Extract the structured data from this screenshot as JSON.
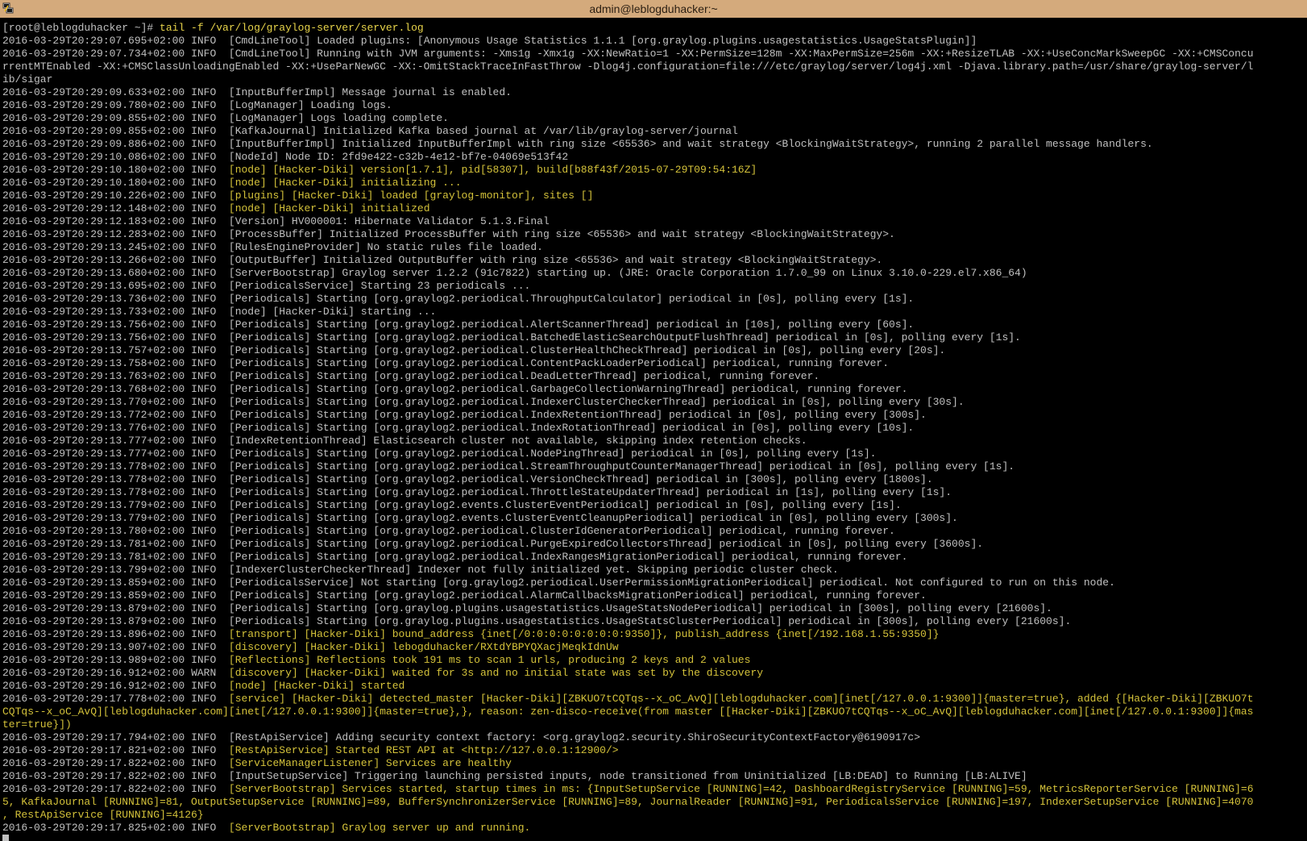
{
  "window": {
    "title": "admin@leblogduhacker:~",
    "icon": "putty-icon"
  },
  "terminal": {
    "prompt": "[root@leblogduhacker ~]# ",
    "command": "tail -f /var/log/graylog-server/server.log",
    "colors": {
      "background": "#000000",
      "foreground": "#c0c0c0",
      "highlight": "#d4c23a",
      "titlebar": "#d4aa7c"
    },
    "lines": [
      {
        "ts": "2016-03-29T20:29:07.695+02:00",
        "lvl": "INFO ",
        "msg": "[CmdLineTool] Loaded plugins: [Anonymous Usage Statistics 1.1.1 [org.graylog.plugins.usagestatistics.UsageStatsPlugin]]",
        "hl": false
      },
      {
        "ts": "2016-03-29T20:29:07.734+02:00",
        "lvl": "INFO ",
        "msg": "[CmdLineTool] Running with JVM arguments: -Xms1g -Xmx1g -XX:NewRatio=1 -XX:PermSize=128m -XX:MaxPermSize=256m -XX:+ResizeTLAB -XX:+UseConcMarkSweepGC -XX:+CMSConcu",
        "hl": false
      },
      {
        "raw": "rrentMTEnabled -XX:+CMSClassUnloadingEnabled -XX:+UseParNewGC -XX:-OmitStackTraceInFastThrow -Dlog4j.configuration=file:///etc/graylog/server/log4j.xml -Djava.library.path=/usr/share/graylog-server/l",
        "hl": false
      },
      {
        "raw": "ib/sigar",
        "hl": false
      },
      {
        "ts": "2016-03-29T20:29:09.633+02:00",
        "lvl": "INFO ",
        "msg": "[InputBufferImpl] Message journal is enabled.",
        "hl": false
      },
      {
        "ts": "2016-03-29T20:29:09.780+02:00",
        "lvl": "INFO ",
        "msg": "[LogManager] Loading logs.",
        "hl": false
      },
      {
        "ts": "2016-03-29T20:29:09.855+02:00",
        "lvl": "INFO ",
        "msg": "[LogManager] Logs loading complete.",
        "hl": false
      },
      {
        "ts": "2016-03-29T20:29:09.855+02:00",
        "lvl": "INFO ",
        "msg": "[KafkaJournal] Initialized Kafka based journal at /var/lib/graylog-server/journal",
        "hl": false
      },
      {
        "ts": "2016-03-29T20:29:09.886+02:00",
        "lvl": "INFO ",
        "msg": "[InputBufferImpl] Initialized InputBufferImpl with ring size <65536> and wait strategy <BlockingWaitStrategy>, running 2 parallel message handlers.",
        "hl": false
      },
      {
        "ts": "2016-03-29T20:29:10.086+02:00",
        "lvl": "INFO ",
        "msg": "[NodeId] Node ID: 2fd9e422-c32b-4e12-bf7e-04069e513f42",
        "hl": false
      },
      {
        "ts": "2016-03-29T20:29:10.180+02:00",
        "lvl": "INFO ",
        "msg": "[node] [Hacker-Diki] version[1.7.1], pid[58307], build[b88f43f/2015-07-29T09:54:16Z]",
        "hl": true
      },
      {
        "ts": "2016-03-29T20:29:10.180+02:00",
        "lvl": "INFO ",
        "msg": "[node] [Hacker-Diki] initializing ...",
        "hl": true
      },
      {
        "ts": "2016-03-29T20:29:10.226+02:00",
        "lvl": "INFO ",
        "msg": "[plugins] [Hacker-Diki] loaded [graylog-monitor], sites []",
        "hl": true
      },
      {
        "ts": "2016-03-29T20:29:12.148+02:00",
        "lvl": "INFO ",
        "msg": "[node] [Hacker-Diki] initialized",
        "hl": true
      },
      {
        "ts": "2016-03-29T20:29:12.183+02:00",
        "lvl": "INFO ",
        "msg": "[Version] HV000001: Hibernate Validator 5.1.3.Final",
        "hl": false
      },
      {
        "ts": "2016-03-29T20:29:12.283+02:00",
        "lvl": "INFO ",
        "msg": "[ProcessBuffer] Initialized ProcessBuffer with ring size <65536> and wait strategy <BlockingWaitStrategy>.",
        "hl": false
      },
      {
        "ts": "2016-03-29T20:29:13.245+02:00",
        "lvl": "INFO ",
        "msg": "[RulesEngineProvider] No static rules file loaded.",
        "hl": false
      },
      {
        "ts": "2016-03-29T20:29:13.266+02:00",
        "lvl": "INFO ",
        "msg": "[OutputBuffer] Initialized OutputBuffer with ring size <65536> and wait strategy <BlockingWaitStrategy>.",
        "hl": false
      },
      {
        "ts": "2016-03-29T20:29:13.680+02:00",
        "lvl": "INFO ",
        "msg": "[ServerBootstrap] Graylog server 1.2.2 (91c7822) starting up. (JRE: Oracle Corporation 1.7.0_99 on Linux 3.10.0-229.el7.x86_64)",
        "hl": false
      },
      {
        "ts": "2016-03-29T20:29:13.695+02:00",
        "lvl": "INFO ",
        "msg": "[PeriodicalsService] Starting 23 periodicals ...",
        "hl": false
      },
      {
        "ts": "2016-03-29T20:29:13.736+02:00",
        "lvl": "INFO ",
        "msg": "[Periodicals] Starting [org.graylog2.periodical.ThroughputCalculator] periodical in [0s], polling every [1s].",
        "hl": false
      },
      {
        "ts": "2016-03-29T20:29:13.733+02:00",
        "lvl": "INFO ",
        "msg": "[node] [Hacker-Diki] starting ...",
        "hl": false
      },
      {
        "ts": "2016-03-29T20:29:13.756+02:00",
        "lvl": "INFO ",
        "msg": "[Periodicals] Starting [org.graylog2.periodical.AlertScannerThread] periodical in [10s], polling every [60s].",
        "hl": false
      },
      {
        "ts": "2016-03-29T20:29:13.756+02:00",
        "lvl": "INFO ",
        "msg": "[Periodicals] Starting [org.graylog2.periodical.BatchedElasticSearchOutputFlushThread] periodical in [0s], polling every [1s].",
        "hl": false
      },
      {
        "ts": "2016-03-29T20:29:13.757+02:00",
        "lvl": "INFO ",
        "msg": "[Periodicals] Starting [org.graylog2.periodical.ClusterHealthCheckThread] periodical in [0s], polling every [20s].",
        "hl": false
      },
      {
        "ts": "2016-03-29T20:29:13.758+02:00",
        "lvl": "INFO ",
        "msg": "[Periodicals] Starting [org.graylog2.periodical.ContentPackLoaderPeriodical] periodical, running forever.",
        "hl": false
      },
      {
        "ts": "2016-03-29T20:29:13.763+02:00",
        "lvl": "INFO ",
        "msg": "[Periodicals] Starting [org.graylog2.periodical.DeadLetterThread] periodical, running forever.",
        "hl": false
      },
      {
        "ts": "2016-03-29T20:29:13.768+02:00",
        "lvl": "INFO ",
        "msg": "[Periodicals] Starting [org.graylog2.periodical.GarbageCollectionWarningThread] periodical, running forever.",
        "hl": false
      },
      {
        "ts": "2016-03-29T20:29:13.770+02:00",
        "lvl": "INFO ",
        "msg": "[Periodicals] Starting [org.graylog2.periodical.IndexerClusterCheckerThread] periodical in [0s], polling every [30s].",
        "hl": false
      },
      {
        "ts": "2016-03-29T20:29:13.772+02:00",
        "lvl": "INFO ",
        "msg": "[Periodicals] Starting [org.graylog2.periodical.IndexRetentionThread] periodical in [0s], polling every [300s].",
        "hl": false
      },
      {
        "ts": "2016-03-29T20:29:13.776+02:00",
        "lvl": "INFO ",
        "msg": "[Periodicals] Starting [org.graylog2.periodical.IndexRotationThread] periodical in [0s], polling every [10s].",
        "hl": false
      },
      {
        "ts": "2016-03-29T20:29:13.777+02:00",
        "lvl": "INFO ",
        "msg": "[IndexRetentionThread] Elasticsearch cluster not available, skipping index retention checks.",
        "hl": false
      },
      {
        "ts": "2016-03-29T20:29:13.777+02:00",
        "lvl": "INFO ",
        "msg": "[Periodicals] Starting [org.graylog2.periodical.NodePingThread] periodical in [0s], polling every [1s].",
        "hl": false
      },
      {
        "ts": "2016-03-29T20:29:13.778+02:00",
        "lvl": "INFO ",
        "msg": "[Periodicals] Starting [org.graylog2.periodical.StreamThroughputCounterManagerThread] periodical in [0s], polling every [1s].",
        "hl": false
      },
      {
        "ts": "2016-03-29T20:29:13.778+02:00",
        "lvl": "INFO ",
        "msg": "[Periodicals] Starting [org.graylog2.periodical.VersionCheckThread] periodical in [300s], polling every [1800s].",
        "hl": false
      },
      {
        "ts": "2016-03-29T20:29:13.778+02:00",
        "lvl": "INFO ",
        "msg": "[Periodicals] Starting [org.graylog2.periodical.ThrottleStateUpdaterThread] periodical in [1s], polling every [1s].",
        "hl": false
      },
      {
        "ts": "2016-03-29T20:29:13.779+02:00",
        "lvl": "INFO ",
        "msg": "[Periodicals] Starting [org.graylog2.events.ClusterEventPeriodical] periodical in [0s], polling every [1s].",
        "hl": false
      },
      {
        "ts": "2016-03-29T20:29:13.779+02:00",
        "lvl": "INFO ",
        "msg": "[Periodicals] Starting [org.graylog2.events.ClusterEventCleanupPeriodical] periodical in [0s], polling every [300s].",
        "hl": false
      },
      {
        "ts": "2016-03-29T20:29:13.780+02:00",
        "lvl": "INFO ",
        "msg": "[Periodicals] Starting [org.graylog2.periodical.ClusterIdGeneratorPeriodical] periodical, running forever.",
        "hl": false
      },
      {
        "ts": "2016-03-29T20:29:13.781+02:00",
        "lvl": "INFO ",
        "msg": "[Periodicals] Starting [org.graylog2.periodical.PurgeExpiredCollectorsThread] periodical in [0s], polling every [3600s].",
        "hl": false
      },
      {
        "ts": "2016-03-29T20:29:13.781+02:00",
        "lvl": "INFO ",
        "msg": "[Periodicals] Starting [org.graylog2.periodical.IndexRangesMigrationPeriodical] periodical, running forever.",
        "hl": false
      },
      {
        "ts": "2016-03-29T20:29:13.799+02:00",
        "lvl": "INFO ",
        "msg": "[IndexerClusterCheckerThread] Indexer not fully initialized yet. Skipping periodic cluster check.",
        "hl": false
      },
      {
        "ts": "2016-03-29T20:29:13.859+02:00",
        "lvl": "INFO ",
        "msg": "[PeriodicalsService] Not starting [org.graylog2.periodical.UserPermissionMigrationPeriodical] periodical. Not configured to run on this node.",
        "hl": false
      },
      {
        "ts": "2016-03-29T20:29:13.859+02:00",
        "lvl": "INFO ",
        "msg": "[Periodicals] Starting [org.graylog2.periodical.AlarmCallbacksMigrationPeriodical] periodical, running forever.",
        "hl": false
      },
      {
        "ts": "2016-03-29T20:29:13.879+02:00",
        "lvl": "INFO ",
        "msg": "[Periodicals] Starting [org.graylog.plugins.usagestatistics.UsageStatsNodePeriodical] periodical in [300s], polling every [21600s].",
        "hl": false
      },
      {
        "ts": "2016-03-29T20:29:13.879+02:00",
        "lvl": "INFO ",
        "msg": "[Periodicals] Starting [org.graylog.plugins.usagestatistics.UsageStatsClusterPeriodical] periodical in [300s], polling every [21600s].",
        "hl": false
      },
      {
        "ts": "2016-03-29T20:29:13.896+02:00",
        "lvl": "INFO ",
        "msg": "[transport] [Hacker-Diki] bound_address {inet[/0:0:0:0:0:0:0:0:9350]}, publish_address {inet[/192.168.1.55:9350]}",
        "hl": true
      },
      {
        "ts": "2016-03-29T20:29:13.907+02:00",
        "lvl": "INFO ",
        "msg": "[discovery] [Hacker-Diki] lebogduhacker/RXtdYBPYQXacjMeqkIdnUw",
        "hl": true
      },
      {
        "ts": "2016-03-29T20:29:13.989+02:00",
        "lvl": "INFO ",
        "msg": "[Reflections] Reflections took 191 ms to scan 1 urls, producing 2 keys and 2 values",
        "hl": true
      },
      {
        "ts": "2016-03-29T20:29:16.912+02:00",
        "lvl": "WARN ",
        "msg": "[discovery] [Hacker-Diki] waited for 3s and no initial state was set by the discovery",
        "hl": true
      },
      {
        "ts": "2016-03-29T20:29:16.912+02:00",
        "lvl": "INFO ",
        "msg": "[node] [Hacker-Diki] started",
        "hl": true
      },
      {
        "ts": "2016-03-29T20:29:17.778+02:00",
        "lvl": "INFO ",
        "msg": "[service] [Hacker-Diki] detected_master [Hacker-Diki][ZBKUO7tCQTqs--x_oC_AvQ][leblogduhacker.com][inet[/127.0.0.1:9300]]{master=true}, added {[Hacker-Diki][ZBKUO7t",
        "hl": true
      },
      {
        "raw": "CQTqs--x_oC_AvQ][leblogduhacker.com][inet[/127.0.0.1:9300]]{master=true},}, reason: zen-disco-receive(from master [[Hacker-Diki][ZBKUO7tCQTqs--x_oC_AvQ][leblogduhacker.com][inet[/127.0.0.1:9300]]{mas",
        "hl": true
      },
      {
        "raw": "ter=true}])",
        "hl": true
      },
      {
        "ts": "2016-03-29T20:29:17.794+02:00",
        "lvl": "INFO ",
        "msg": "[RestApiService] Adding security context factory: <org.graylog2.security.ShiroSecurityContextFactory@6190917c>",
        "hl": false
      },
      {
        "ts": "2016-03-29T20:29:17.821+02:00",
        "lvl": "INFO ",
        "msg": "[RestApiService] Started REST API at <http://127.0.0.1:12900/>",
        "hl": true
      },
      {
        "ts": "2016-03-29T20:29:17.822+02:00",
        "lvl": "INFO ",
        "msg": "[ServiceManagerListener] Services are healthy",
        "hl": true
      },
      {
        "ts": "2016-03-29T20:29:17.822+02:00",
        "lvl": "INFO ",
        "msg": "[InputSetupService] Triggering launching persisted inputs, node transitioned from Uninitialized [LB:DEAD] to Running [LB:ALIVE]",
        "hl": false
      },
      {
        "ts": "2016-03-29T20:29:17.822+02:00",
        "lvl": "INFO ",
        "msg": "[ServerBootstrap] Services started, startup times in ms: {InputSetupService [RUNNING]=42, DashboardRegistryService [RUNNING]=59, MetricsReporterService [RUNNING]=6",
        "hl": true
      },
      {
        "raw": "5, KafkaJournal [RUNNING]=81, OutputSetupService [RUNNING]=89, BufferSynchronizerService [RUNNING]=89, JournalReader [RUNNING]=91, PeriodicalsService [RUNNING]=197, IndexerSetupService [RUNNING]=4070",
        "hl": true
      },
      {
        "raw": ", RestApiService [RUNNING]=4126}",
        "hl": true
      },
      {
        "ts": "2016-03-29T20:29:17.825+02:00",
        "lvl": "INFO ",
        "msg": "[ServerBootstrap] Graylog server up and running.",
        "hl": true
      }
    ]
  }
}
